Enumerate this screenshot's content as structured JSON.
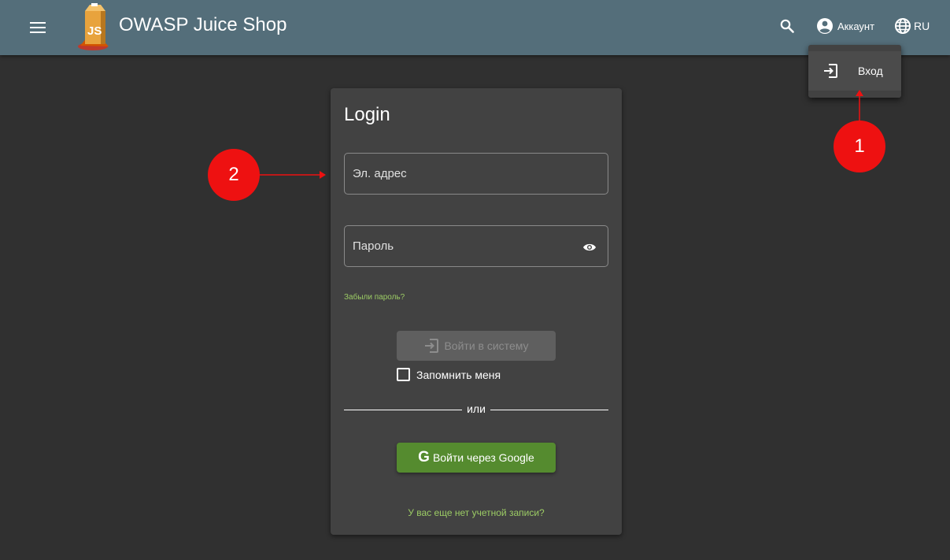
{
  "header": {
    "title": "OWASP Juice Shop",
    "account_label": "Аккаунт",
    "language_label": "RU",
    "icons": {
      "menu": "menu-icon",
      "search": "search-icon",
      "account": "account-circle-icon",
      "language": "globe-icon"
    }
  },
  "account_menu": {
    "items": [
      {
        "label": "Вход",
        "icon": "login-icon"
      }
    ]
  },
  "login": {
    "title": "Login",
    "email_placeholder": "Эл. адрес",
    "password_placeholder": "Пароль",
    "forgot_password": "Забыли пароль?",
    "submit_label": "Войти в систему",
    "remember_me": "Запомнить меня",
    "divider": "или",
    "google_letter": "G",
    "google_label": "Войти через Google",
    "register_link": "У вас еще нет учетной записи?"
  },
  "annotations": {
    "callout_1": "1",
    "callout_2": "2"
  },
  "colors": {
    "toolbar": "#546e7a",
    "background": "#303030",
    "card": "#424242",
    "accent_link": "#9ccc65",
    "google_button": "#558b2f",
    "callout": "#ee1111"
  }
}
